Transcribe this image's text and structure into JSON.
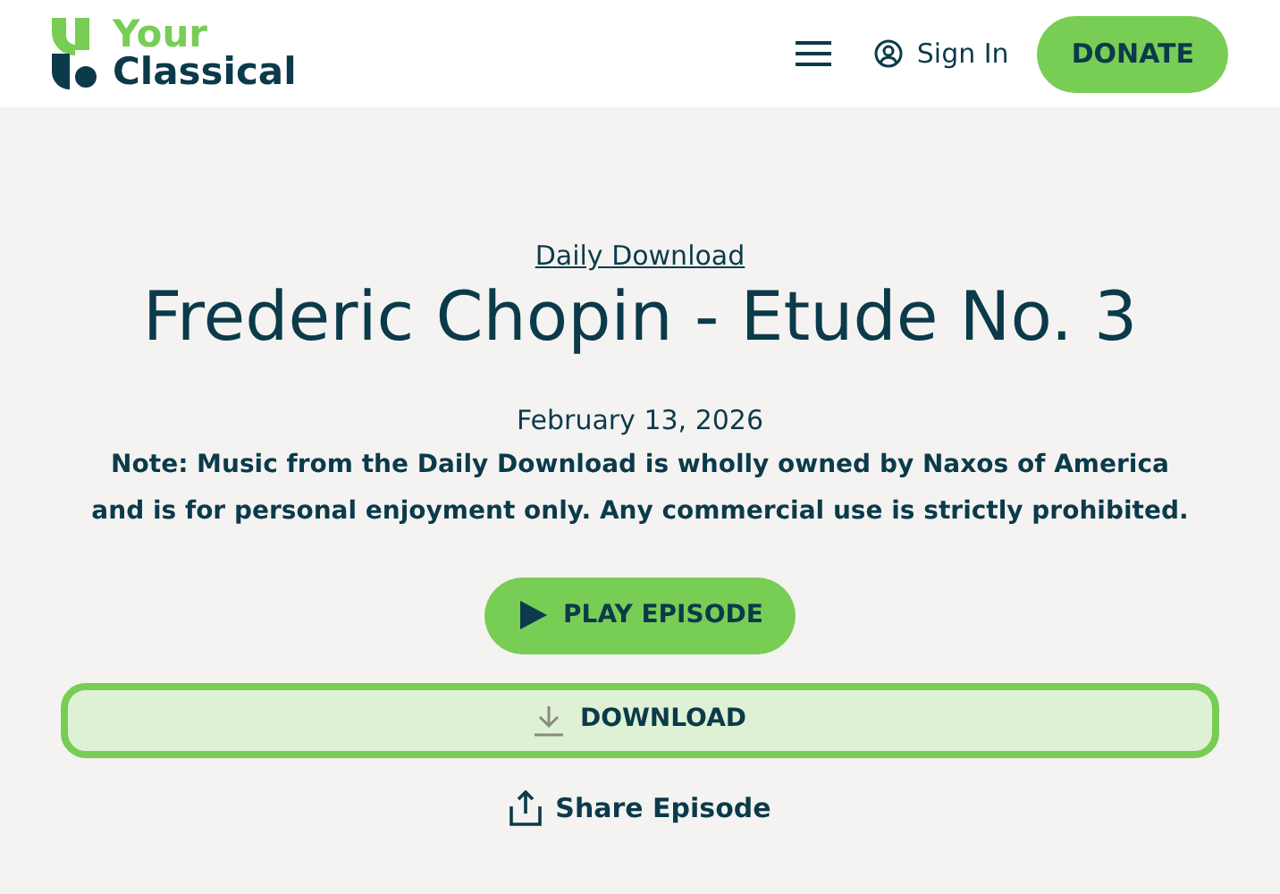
{
  "header": {
    "logo": {
      "line_1": "Your",
      "line_2": "Classical"
    },
    "nav": {
      "sign_in": "Sign In",
      "donate": "DONATE"
    }
  },
  "episode": {
    "category": "Daily Download",
    "title": "Frederic Chopin - Etude No. 3",
    "date": "February 13, 2026",
    "note": "Note: Music from the Daily Download is wholly owned by Naxos of America and is for personal enjoyment only. Any commercial use is strictly prohibited.",
    "play": "PLAY EPISODE",
    "download": "DOWNLOAD",
    "share": "Share Episode"
  }
}
